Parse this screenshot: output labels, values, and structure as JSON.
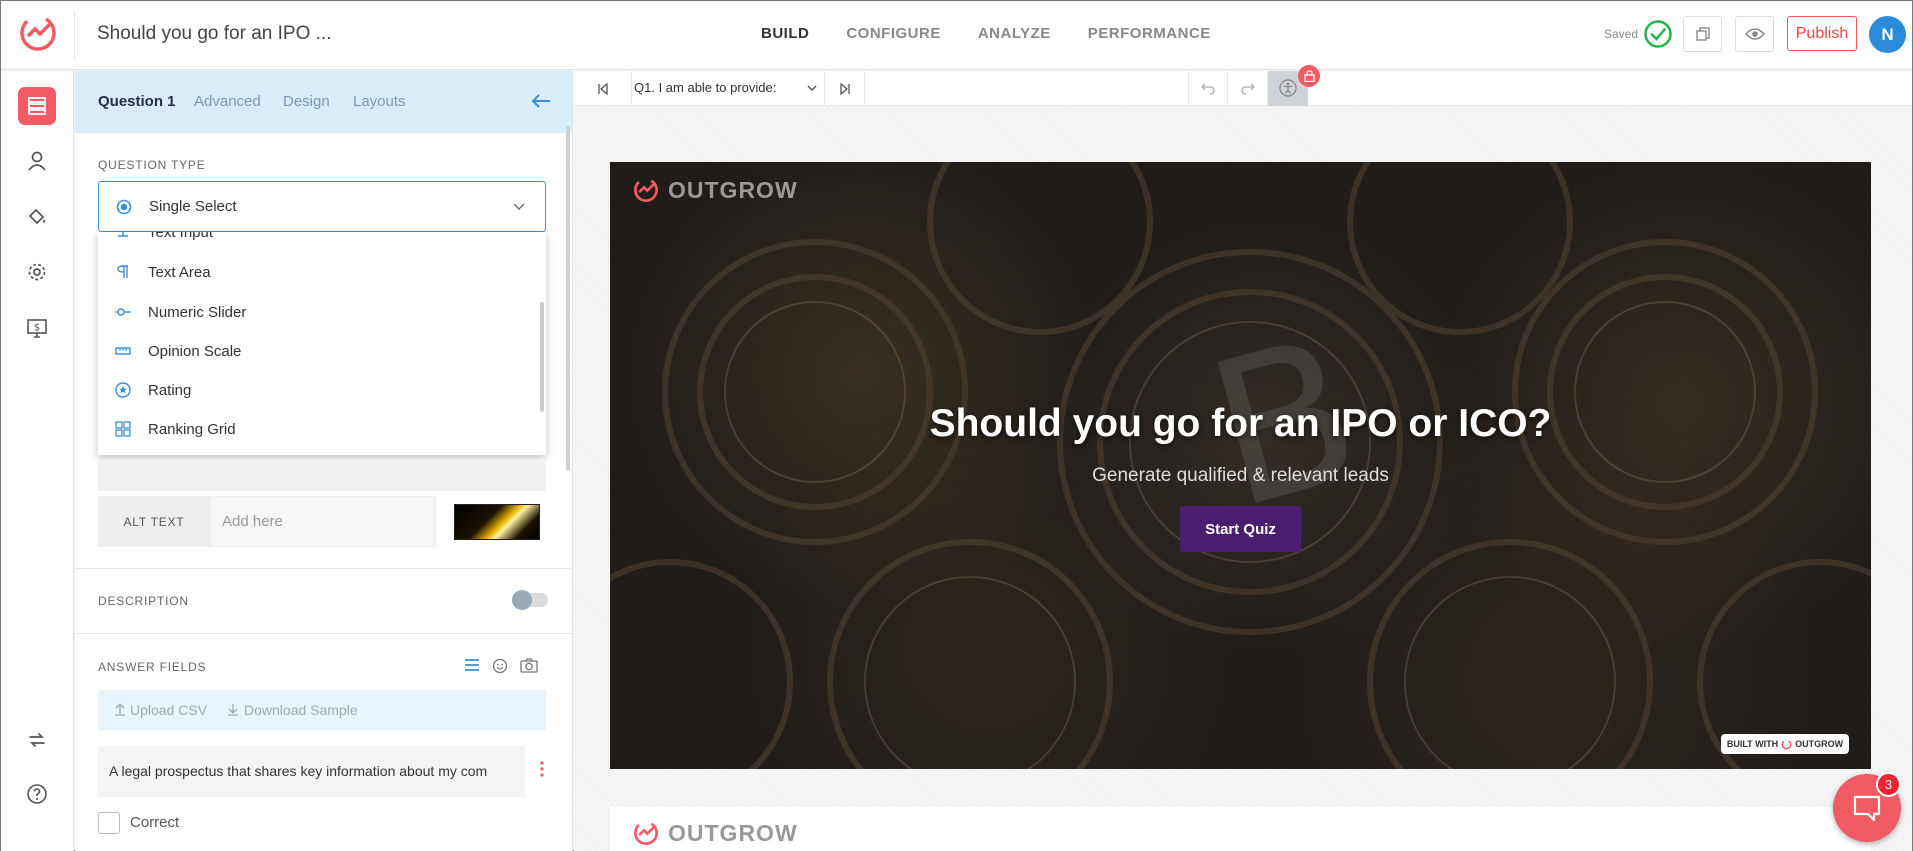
{
  "app": {
    "title": "Should you go for an IPO ...",
    "nav": [
      "BUILD",
      "CONFIGURE",
      "ANALYZE",
      "PERFORMANCE"
    ],
    "saved_label": "Saved",
    "publish_label": "Publish",
    "avatar_initial": "N"
  },
  "panel": {
    "tabs": [
      "Question 1",
      "Advanced",
      "Design",
      "Layouts"
    ],
    "question_type_label": "QUESTION TYPE",
    "question_type_value": "Single Select",
    "dropdown_options": [
      {
        "label": "Text Input",
        "icon": "text-input-icon"
      },
      {
        "label": "Text Area",
        "icon": "text-area-icon"
      },
      {
        "label": "Numeric Slider",
        "icon": "slider-icon"
      },
      {
        "label": "Opinion Scale",
        "icon": "scale-icon"
      },
      {
        "label": "Rating",
        "icon": "star-icon"
      },
      {
        "label": "Ranking Grid",
        "icon": "grid-icon"
      }
    ],
    "alt_text_label": "ALT TEXT",
    "alt_text_placeholder": "Add here",
    "description_label": "DESCRIPTION",
    "answer_fields_label": "ANSWER FIELDS",
    "upload_csv": "Upload CSV",
    "download_sample": "Download Sample",
    "answer_1": "A legal prospectus that shares key information about my com",
    "correct_label": "Correct"
  },
  "toolbar": {
    "question_select": "Q1. I am able to provide:"
  },
  "hero": {
    "logo_word": "OUTGROW",
    "title": "Should you go for an IPO or ICO?",
    "subtitle": "Generate qualified & relevant leads",
    "cta": "Start Quiz",
    "built_with": "BUILT WITH",
    "built_with_brand": "OUTGROW"
  },
  "chat": {
    "badge": "3"
  },
  "colors": {
    "brand": "#f25b63",
    "accent": "#3a8fd6",
    "cta": "#4a1d6e"
  }
}
